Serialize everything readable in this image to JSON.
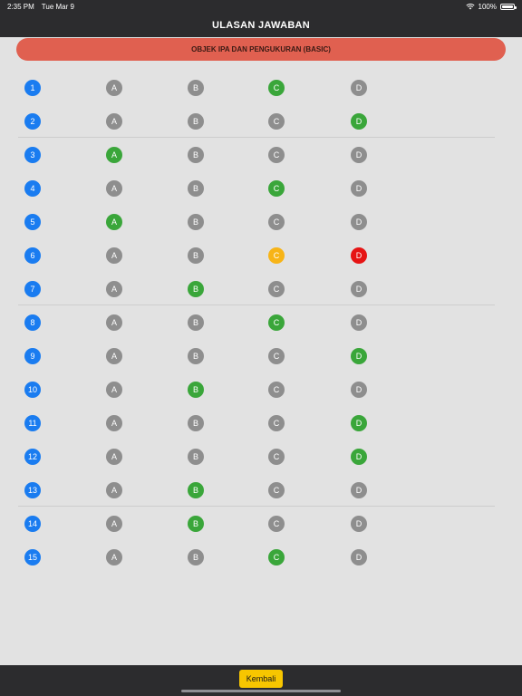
{
  "status": {
    "time": "2:35 PM",
    "date": "Tue Mar 9",
    "battery": "100%"
  },
  "nav": {
    "title": "ULASAN JAWABAN"
  },
  "banner": {
    "text": "OBJEK IPA DAN PENGUKURAN (BASIC)"
  },
  "colors": {
    "blue": "#1a7cf0",
    "gray": "#8e8e8e",
    "green": "#3aa63a",
    "yellow": "#f7b417",
    "red": "#e61414"
  },
  "options": [
    "A",
    "B",
    "C",
    "D"
  ],
  "answers": [
    {
      "number": "1",
      "correct": "C"
    },
    {
      "number": "2",
      "correct": "D"
    },
    {
      "number": "3",
      "correct": "A"
    },
    {
      "number": "4",
      "correct": "C"
    },
    {
      "number": "5",
      "correct": "A"
    },
    {
      "number": "6",
      "correct": "D",
      "chosen": "C",
      "wrong": "D"
    },
    {
      "number": "7",
      "correct": "B"
    },
    {
      "number": "8",
      "correct": "C"
    },
    {
      "number": "9",
      "correct": "D"
    },
    {
      "number": "10",
      "correct": "B"
    },
    {
      "number": "11",
      "correct": "D"
    },
    {
      "number": "12",
      "correct": "D"
    },
    {
      "number": "13",
      "correct": "B"
    },
    {
      "number": "14",
      "correct": "B"
    },
    {
      "number": "15",
      "correct": "C"
    }
  ],
  "footer": {
    "back_label": "Kembali"
  }
}
